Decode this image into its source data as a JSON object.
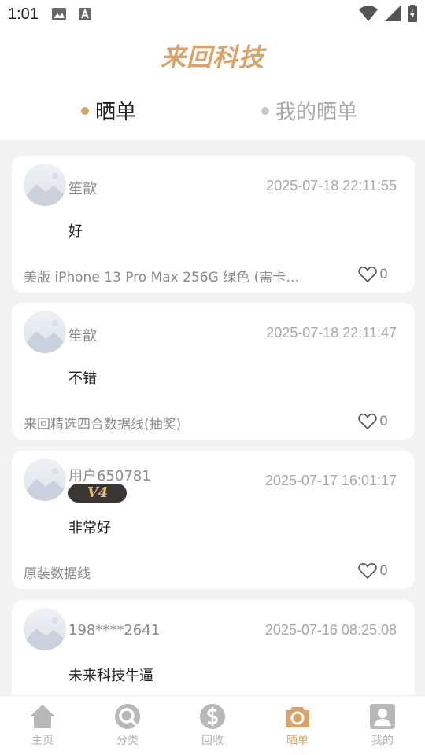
{
  "status_bar": {
    "time": "1:01"
  },
  "header": {
    "logo": "来回科技"
  },
  "tabs": [
    {
      "label": "晒单",
      "active": true
    },
    {
      "label": "我的晒单",
      "active": false
    }
  ],
  "posts": [
    {
      "username": "笙歆",
      "date": "2025-07-18 22:11:55",
      "comment": "好",
      "product": "美版 iPhone 13 Pro Max 256G 绿色 (需卡…",
      "likes": "0"
    },
    {
      "username": "笙歆",
      "date": "2025-07-18 22:11:47",
      "comment": "不错",
      "product": "来回精选四合数据线(抽奖)",
      "likes": "0"
    },
    {
      "username": "用户650781",
      "badge": "V4",
      "date": "2025-07-17 16:01:17",
      "comment": "非常好",
      "product": "原装数据线",
      "likes": "0"
    },
    {
      "username": "198****2641",
      "date": "2025-07-16 08:25:08",
      "comment": "未来科技牛逼",
      "product": "",
      "likes": ""
    }
  ],
  "bottom_nav": [
    {
      "label": "主页",
      "icon": "home-icon",
      "active": false
    },
    {
      "label": "分类",
      "icon": "category-search-icon",
      "active": false
    },
    {
      "label": "回收",
      "icon": "recycle-dollar-icon",
      "active": false
    },
    {
      "label": "晒单",
      "icon": "camera-icon",
      "active": true
    },
    {
      "label": "我的",
      "icon": "user-icon",
      "active": false
    }
  ],
  "colors": {
    "accent": "#d9a26a",
    "inactive": "#b0b0b0",
    "background": "#f3f3f3"
  }
}
